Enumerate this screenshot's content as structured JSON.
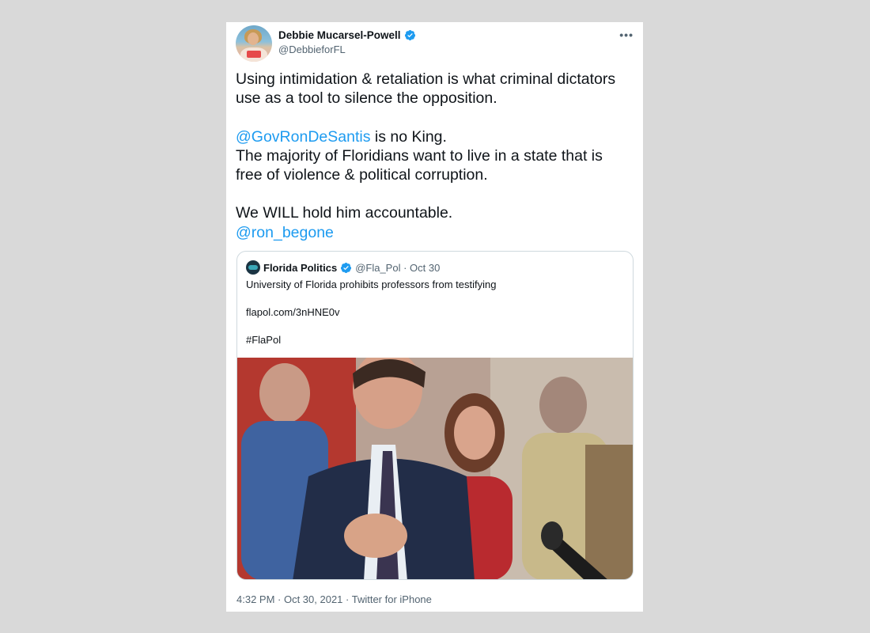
{
  "tweet": {
    "author": {
      "display_name": "Debbie Mucarsel-Powell",
      "handle": "@DebbieforFL",
      "verified": true
    },
    "more_icon": "more-horizontal-icon",
    "text": {
      "line1": "Using intimidation & retaliation is what criminal dictators use as a tool to silence the opposition.",
      "mention1": "@GovRonDeSantis",
      "line2_rest": " is no King.",
      "line3": "The majority of Floridians want to live in a state that is free of violence & political corruption.",
      "line4": "We WILL hold him accountable.",
      "mention2": "@ron_begone"
    },
    "footer": "4:32 PM · Oct 30, 2021 · Twitter for iPhone"
  },
  "quoted": {
    "display_name": "Florida Politics",
    "verified": true,
    "handle_date": "@Fla_Pol · Oct 30",
    "headline": "University of Florida prohibits professors from testifying",
    "link": "flapol.com/3nHNE0v",
    "hashtag": "#FlaPol"
  },
  "colors": {
    "mention": "#1d9bf0",
    "verified": "#1d9bf0",
    "muted": "#536471",
    "page_bg": "#d9d9d9"
  }
}
